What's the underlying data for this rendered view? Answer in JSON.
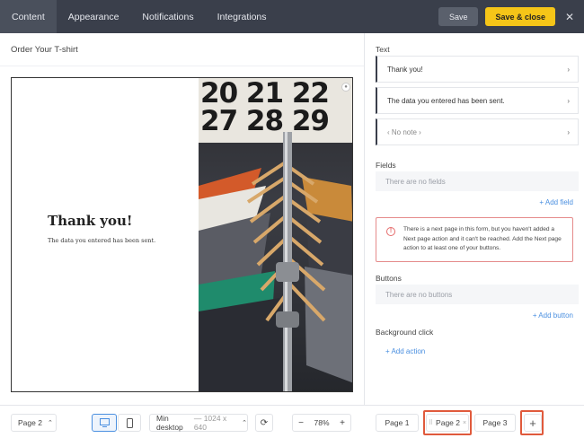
{
  "topbar": {
    "tabs": [
      "Content",
      "Appearance",
      "Notifications",
      "Integrations"
    ],
    "save_label": "Save",
    "save_close_label": "Save & close",
    "close_glyph": "✕"
  },
  "form": {
    "title": "Order Your T-shirt",
    "canvas_heading": "Thank you!",
    "canvas_body": "The data you entered has been sent.",
    "photo_numbers": "20 21 22\n27 28 29"
  },
  "panel": {
    "text_label": "Text",
    "text_items": [
      "Thank you!",
      "The data you entered has been sent.",
      "‹ No note ›"
    ],
    "fields_label": "Fields",
    "fields_empty": "There are no fields",
    "add_field": "+ Add field",
    "alert_text": "There is a next page in this form, but you haven't added a Next page action and it can't be reached. Add the Next page action to at least one of your buttons.",
    "buttons_label": "Buttons",
    "buttons_empty": "There are no buttons",
    "add_button": "+ Add button",
    "background_label": "Background click",
    "add_action": "+ Add action"
  },
  "bottom": {
    "page_select": "Page 2",
    "device_mode": "Min desktop",
    "device_size": "— 1024 x 640",
    "zoom": "78%",
    "pages": [
      "Page 1",
      "Page 2",
      "Page 3"
    ],
    "add_page": "+"
  },
  "colors": {
    "accent": "#f5c518",
    "topbar": "#3a3f4b",
    "link": "#4a8fe0",
    "alert": "#e56b6b",
    "highlight": "#e05a3c"
  }
}
